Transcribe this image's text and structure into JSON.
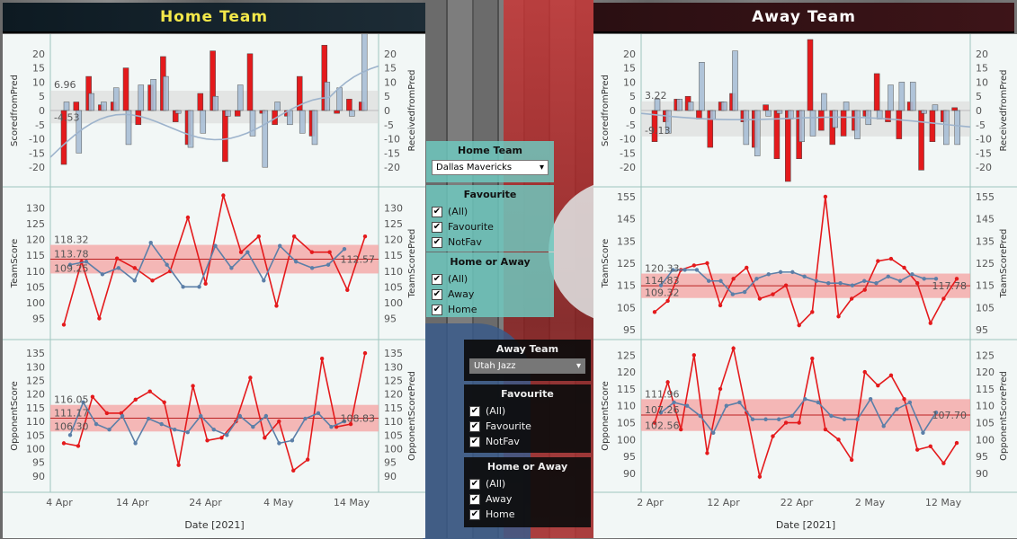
{
  "headers": {
    "home": "Home Team",
    "away": "Away Team"
  },
  "filters": {
    "home": {
      "team_title": "Home Team",
      "team_value": "Dallas Mavericks",
      "fav_title": "Favourite",
      "fav_items": [
        "(All)",
        "Favourite",
        "NotFav"
      ],
      "ha_title": "Home or Away",
      "ha_items": [
        "(All)",
        "Away",
        "Home"
      ]
    },
    "away": {
      "team_title": "Away Team",
      "team_value": "Utah Jazz",
      "fav_title": "Favourite",
      "fav_items": [
        "(All)",
        "Favourite",
        "NotFav"
      ],
      "ha_title": "Home or Away",
      "ha_items": [
        "(All)",
        "Away",
        "Home"
      ]
    }
  },
  "colors": {
    "red": "#e41a1c",
    "blue": "#5b7fa8",
    "band": "#f4a6a6",
    "lightblue": "#a9bfd6",
    "grey": "#d9d9d9"
  },
  "chart_data": [
    {
      "id": "home",
      "type": "combo",
      "xlabel": "Date [2021]",
      "xticks": [
        "4 Apr",
        "14 Apr",
        "24 Apr",
        "4 May",
        "14 May"
      ],
      "x": [
        0,
        2,
        5,
        6,
        8,
        10,
        12,
        14,
        16,
        18,
        20,
        22,
        24,
        26,
        28,
        30,
        32,
        33,
        35,
        37,
        39,
        41,
        42
      ],
      "rows": [
        {
          "ylabel_left": "ScoredfromPred",
          "ylabel_right": "ReceivedfromPred",
          "yticks": [
            20,
            15,
            10,
            5,
            0,
            -5,
            -10,
            -15,
            -20
          ],
          "ylim": [
            -25,
            25
          ],
          "ref_labels": [
            "6.96",
            "-4.53"
          ],
          "ref_values": [
            6.96,
            -4.53
          ],
          "scored": [
            -19,
            3,
            12,
            2,
            3,
            15,
            -5,
            9,
            19,
            -4,
            -12,
            6,
            21,
            -18,
            -2,
            20,
            -1,
            -5,
            -2,
            12,
            -9,
            23,
            -1,
            4,
            3
          ],
          "received": [
            3,
            -15,
            6,
            3,
            8,
            -12,
            9,
            11,
            12,
            -1,
            -13,
            -8,
            5,
            -2,
            9,
            -9,
            -20,
            3,
            -5,
            -8,
            -12,
            10,
            8,
            -2,
            28
          ]
        },
        {
          "ylabel_left": "TeamScore",
          "ylabel_right": "TeamScorePred",
          "yticks": [
            130,
            125,
            120,
            115,
            110,
            105,
            100,
            95
          ],
          "ylim": [
            90,
            135
          ],
          "ref_labels": [
            "118.32",
            "113.78",
            "109.25"
          ],
          "ref_values": [
            118.32,
            113.78,
            109.25
          ],
          "end_label": "112.57",
          "score": [
            93,
            113,
            95,
            114,
            111,
            107,
            110,
            127,
            106,
            134,
            116,
            121,
            99,
            121,
            116,
            116,
            104,
            121
          ],
          "pred": [
            112,
            113,
            109,
            111,
            107,
            119,
            112,
            105,
            105,
            118,
            111,
            116,
            107,
            118,
            113,
            111,
            112,
            117
          ]
        },
        {
          "ylabel_left": "OpponentScore",
          "ylabel_right": "OpponentScorePred",
          "yticks": [
            135,
            130,
            125,
            120,
            115,
            110,
            105,
            100,
            95,
            90
          ],
          "ylim": [
            86,
            138
          ],
          "ref_labels": [
            "116.05",
            "111.17",
            "106.30"
          ],
          "ref_values": [
            116.05,
            111.17,
            106.3
          ],
          "end_label": "108.83",
          "score": [
            102,
            101,
            119,
            113,
            113,
            118,
            121,
            117,
            94,
            123,
            103,
            104,
            110,
            126,
            104,
            110,
            92,
            96,
            133,
            108,
            109,
            135
          ],
          "pred": [
            105,
            117,
            109,
            107,
            112,
            102,
            111,
            109,
            107,
            106,
            112,
            107,
            105,
            112,
            108,
            112,
            102,
            103,
            111,
            113,
            108,
            110
          ]
        }
      ]
    },
    {
      "id": "away",
      "type": "combo",
      "xlabel": "Date [2021]",
      "xticks": [
        "2 Apr",
        "12 Apr",
        "22 Apr",
        "2 May",
        "12 May"
      ],
      "rows": [
        {
          "ylabel_left": "ScoredfromPred",
          "ylabel_right": "ReceivedfromPred",
          "yticks": [
            20,
            15,
            10,
            5,
            0,
            -5,
            -10,
            -15,
            -20
          ],
          "ylim": [
            -25,
            25
          ],
          "ref_labels": [
            "3.22",
            "-9.13"
          ],
          "ref_values": [
            3.22,
            -9.13
          ],
          "scored": [
            -11,
            -4,
            4,
            5,
            -3,
            -13,
            3,
            6,
            -4,
            -13,
            2,
            -17,
            -25,
            -17,
            25,
            -7,
            -12,
            -9,
            -7,
            -2,
            13,
            -4,
            -10,
            3,
            -21,
            -11,
            -4,
            1
          ],
          "received": [
            4,
            -8,
            4,
            3,
            17,
            -3,
            3,
            21,
            -12,
            -16,
            -2,
            -1,
            -3,
            -11,
            -9,
            6,
            -6,
            3,
            -10,
            -5,
            -3,
            9,
            10,
            10,
            -1,
            2,
            -12,
            -12
          ]
        },
        {
          "ylabel_left": "TeamScore",
          "ylabel_right": "TeamScorePred",
          "yticks": [
            155,
            145,
            135,
            125,
            115,
            105,
            95
          ],
          "ylim": [
            93,
            157
          ],
          "ref_labels": [
            "120.33",
            "114.83",
            "109.32"
          ],
          "ref_values": [
            120.33,
            114.83,
            109.32
          ],
          "end_label": "117.78",
          "score": [
            103,
            108,
            122,
            124,
            125,
            106,
            118,
            123,
            109,
            111,
            115,
            97,
            103,
            155,
            101,
            109,
            113,
            126,
            127,
            123,
            116,
            98,
            109,
            118
          ],
          "pred": [
            115,
            122,
            122,
            122,
            117,
            117,
            111,
            112,
            118,
            120,
            121,
            121,
            119,
            117,
            116,
            116,
            115,
            117,
            116,
            119,
            117,
            120,
            118,
            118
          ]
        },
        {
          "ylabel_left": "OpponentScore",
          "ylabel_right": "OpponentScorePred",
          "yticks": [
            125,
            120,
            115,
            110,
            105,
            100,
            95,
            90
          ],
          "ylim": [
            86,
            128
          ],
          "ref_labels": [
            "111.96",
            "107.26",
            "102.56"
          ],
          "ref_values": [
            111.96,
            107.26,
            102.56
          ],
          "end_label": "107.70",
          "score": [
            105,
            117,
            103,
            125,
            96,
            115,
            127,
            108,
            89,
            101,
            105,
            105,
            124,
            103,
            100,
            94,
            120,
            116,
            119,
            112,
            97,
            98,
            93,
            99
          ],
          "pred": [
            108,
            111,
            110,
            107,
            102,
            110,
            111,
            106,
            106,
            106,
            107,
            112,
            111,
            107,
            106,
            106,
            112,
            104,
            109,
            111,
            102,
            108
          ]
        }
      ]
    }
  ]
}
